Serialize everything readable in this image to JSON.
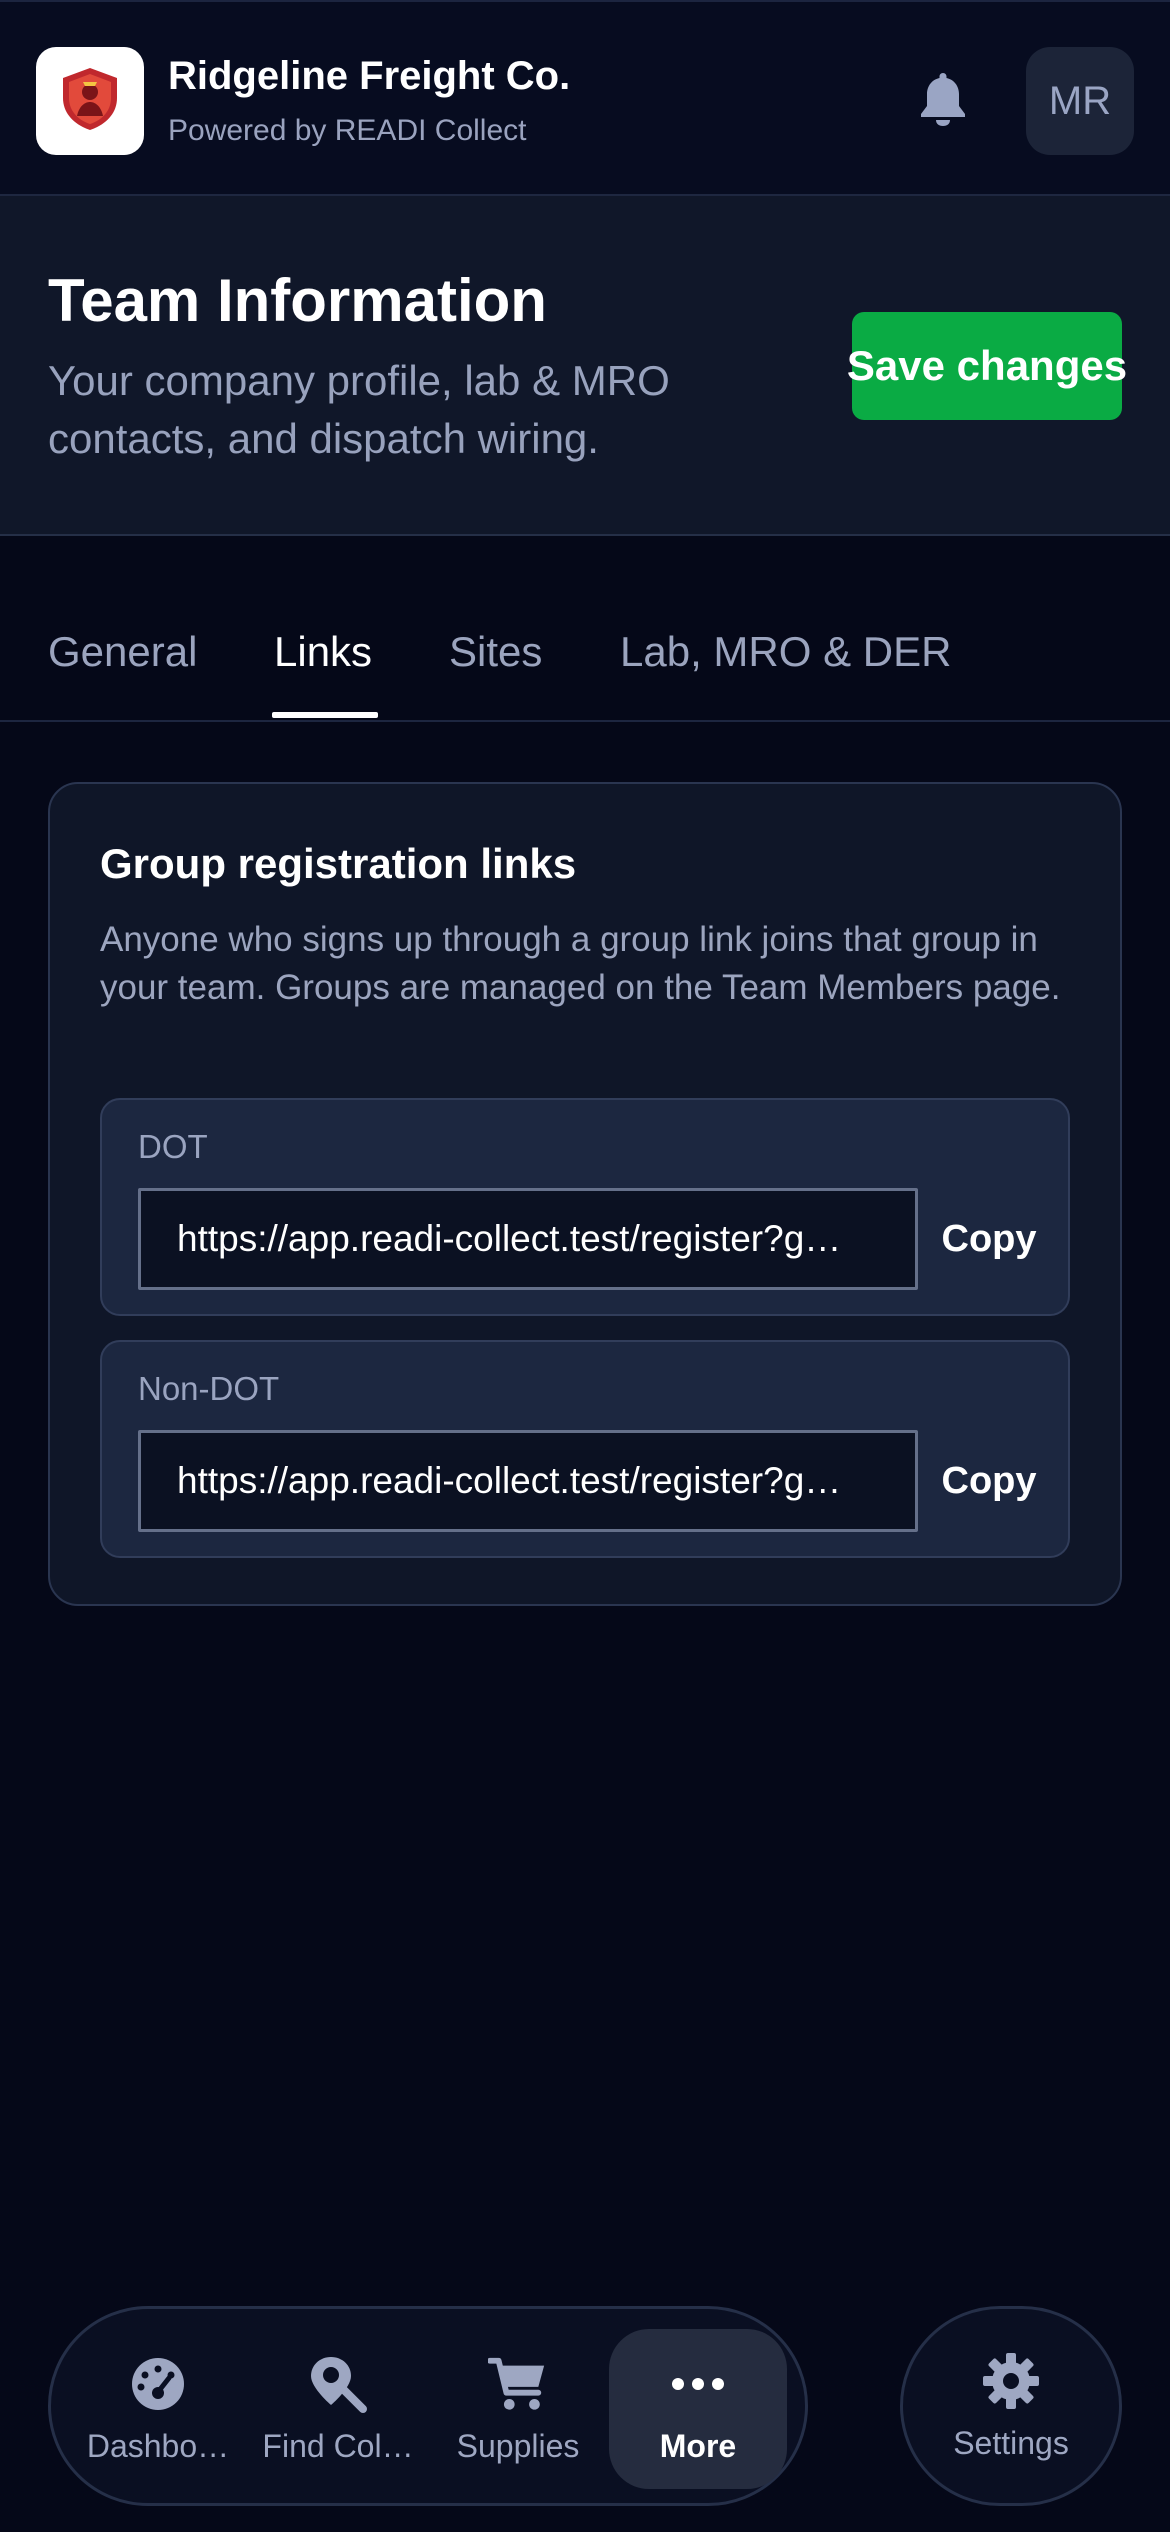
{
  "header": {
    "company_name": "Ridgeline Freight Co.",
    "powered_by": "Powered by READI Collect",
    "avatar_initials": "MR",
    "logo_icon": "shield-badge-icon",
    "notification_icon": "bell-icon"
  },
  "page": {
    "title": "Team Information",
    "description": "Your company profile, lab & MRO contacts, and dispatch wiring.",
    "save_label": "Save changes"
  },
  "tabs": [
    {
      "label": "General",
      "active": false
    },
    {
      "label": "Links",
      "active": true
    },
    {
      "label": "Sites",
      "active": false
    },
    {
      "label": "Lab, MRO & DER",
      "active": false
    }
  ],
  "card": {
    "title": "Group registration links",
    "description": "Anyone who signs up through a group link joins that group in your team. Groups are managed on the Team Members page.",
    "links": [
      {
        "label": "DOT",
        "url": "https://app.readi-collect.test/register?g…",
        "copy_label": "Copy"
      },
      {
        "label": "Non-DOT",
        "url": "https://app.readi-collect.test/register?g…",
        "copy_label": "Copy"
      }
    ]
  },
  "bottom_nav": {
    "items": [
      {
        "label": "Dashbo…",
        "icon": "gauge-icon",
        "active": false
      },
      {
        "label": "Find Col…",
        "icon": "location-search-icon",
        "active": false
      },
      {
        "label": "Supplies",
        "icon": "cart-icon",
        "active": false
      },
      {
        "label": "More",
        "icon": "more-dots-icon",
        "active": true
      }
    ],
    "settings": {
      "label": "Settings",
      "icon": "gear-icon"
    }
  },
  "colors": {
    "background": "#050818",
    "accent_green": "#0aab44",
    "muted_text": "#9aa3bf"
  }
}
